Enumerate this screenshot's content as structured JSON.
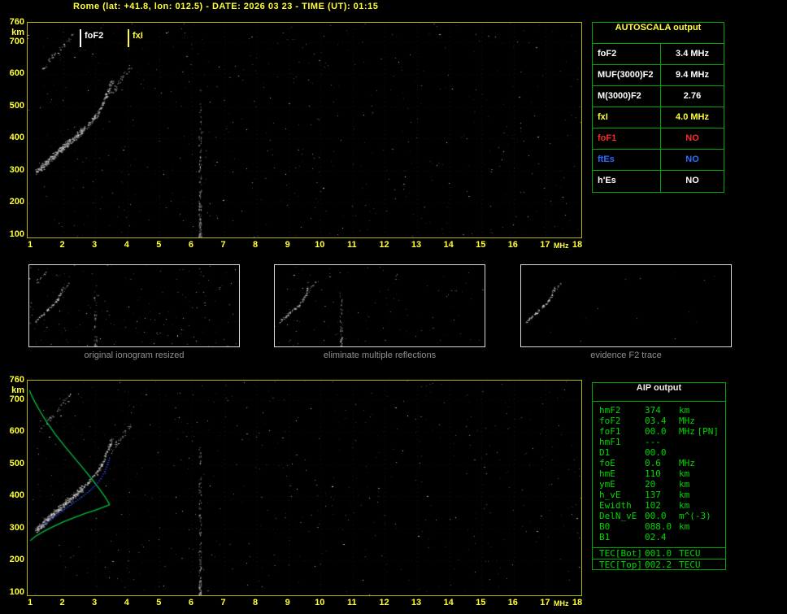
{
  "title": "Rome (lat: +41.8, lon: 012.5) - DATE: 2026 03 23 - TIME (UT): 01:15",
  "colors": {
    "axis_yellow": "#ffff35",
    "plot_border": "#b5b500",
    "table_green": "#00a800",
    "aip_text_green": "#00d800",
    "profile_green": "#00c23c",
    "fit_blue": "#2e4bff",
    "caption_gray": "#8f8f8f",
    "no_red": "#ff2a2a",
    "no_blue": "#2e6bff",
    "white": "#ffffff"
  },
  "autoscala_table": {
    "title": "AUTOSCALA output",
    "rows": [
      {
        "label": "foF2",
        "value": "3.4 MHz",
        "color": "#ffffff"
      },
      {
        "label": "MUF(3000)F2",
        "value": "9.4 MHz",
        "color": "#ffffff"
      },
      {
        "label": "M(3000)F2",
        "value": "2.76",
        "color": "#ffffff"
      },
      {
        "label": "fxI",
        "value": "4.0 MHz",
        "color": "#ffff35"
      },
      {
        "label": "foF1",
        "value": "NO",
        "color": "#ff2a2a"
      },
      {
        "label": "ftEs",
        "value": "NO",
        "color": "#2e6bff"
      },
      {
        "label": "h'Es",
        "value": "NO",
        "color": "#ffffff"
      }
    ]
  },
  "aip_table": {
    "title": "AIP output",
    "rows": [
      {
        "name": "hmF2",
        "value": "374",
        "unit": "km"
      },
      {
        "name": "foF2",
        "value": "03.4",
        "unit": "MHz"
      },
      {
        "name": "foF1",
        "value": "00.0",
        "unit": "MHz",
        "extra": "[PN]"
      },
      {
        "name": "hmF1",
        "value": "---",
        "unit": ""
      },
      {
        "name": "D1",
        "value": "00.0",
        "unit": ""
      },
      {
        "name": "foE",
        "value": "0.6",
        "unit": "MHz"
      },
      {
        "name": "hmE",
        "value": "110",
        "unit": "km"
      },
      {
        "name": "ymE",
        "value": "20",
        "unit": "km"
      },
      {
        "name": "h_vE",
        "value": "137",
        "unit": "km"
      },
      {
        "name": "Ewidth",
        "value": "102",
        "unit": "km"
      },
      {
        "name": "DelN_vE",
        "value": "00.0",
        "unit": "m^(-3)"
      },
      {
        "name": "B0",
        "value": "088.0",
        "unit": "km"
      },
      {
        "name": "B1",
        "value": "02.4",
        "unit": ""
      }
    ],
    "tec_rows": [
      {
        "name": "TEC[Bot]",
        "value": "001.0",
        "unit": "TECU"
      },
      {
        "name": "TEC[Top]",
        "value": "002.2",
        "unit": "TECU"
      }
    ]
  },
  "thumbnails": [
    {
      "caption": "original ionogram resized"
    },
    {
      "caption": "eliminate multiple reflections"
    },
    {
      "caption": "evidence F2 trace"
    }
  ],
  "chart_data": [
    {
      "type": "scatter",
      "title": "measured ionogram",
      "xlabel": "MHz",
      "ylabel": "km",
      "xlim": [
        1,
        18
      ],
      "ylim": [
        92,
        760
      ],
      "x_ticks": [
        1,
        2,
        3,
        4,
        5,
        6,
        7,
        8,
        9,
        10,
        11,
        12,
        13,
        14,
        15,
        16,
        17,
        18
      ],
      "y_ticks": [
        760,
        700,
        600,
        500,
        400,
        300,
        200,
        100
      ],
      "grid": "faint dotted",
      "markers": [
        {
          "label": "foF2",
          "value_mhz": 3.4,
          "color": "#ffffff"
        },
        {
          "label": "fxI",
          "value_mhz": 4.0,
          "color": "#ffff35"
        }
      ],
      "f2_trace": [
        [
          1.15,
          295
        ],
        [
          1.4,
          318
        ],
        [
          1.7,
          346
        ],
        [
          2.0,
          373
        ],
        [
          2.3,
          399
        ],
        [
          2.6,
          426
        ],
        [
          2.85,
          452
        ],
        [
          3.05,
          477
        ],
        [
          3.2,
          502
        ],
        [
          3.32,
          528
        ],
        [
          3.42,
          556
        ],
        [
          3.52,
          580
        ]
      ],
      "x_trace": [
        [
          3.5,
          538
        ],
        [
          3.65,
          563
        ],
        [
          3.8,
          586
        ],
        [
          3.95,
          605
        ],
        [
          4.12,
          620
        ]
      ],
      "second_hop": [
        [
          1.3,
          612
        ],
        [
          1.55,
          640
        ],
        [
          1.8,
          668
        ],
        [
          2.05,
          696
        ],
        [
          2.28,
          720
        ]
      ],
      "interference_mhz": 6.25
    },
    {
      "type": "scatter",
      "title": "ionogram with AIP profile fit",
      "xlabel": "MHz",
      "ylabel": "km",
      "xlim": [
        1,
        18
      ],
      "ylim": [
        92,
        760
      ],
      "x_ticks": [
        1,
        2,
        3,
        4,
        5,
        6,
        7,
        8,
        9,
        10,
        11,
        12,
        13,
        14,
        15,
        16,
        17,
        18
      ],
      "y_ticks": [
        760,
        700,
        600,
        500,
        400,
        300,
        200,
        100
      ],
      "grid": "faint dotted",
      "f2_trace": [
        [
          1.15,
          295
        ],
        [
          1.4,
          318
        ],
        [
          1.7,
          346
        ],
        [
          2.0,
          373
        ],
        [
          2.3,
          399
        ],
        [
          2.6,
          426
        ],
        [
          2.85,
          452
        ],
        [
          3.05,
          477
        ],
        [
          3.2,
          502
        ],
        [
          3.32,
          528
        ],
        [
          3.42,
          556
        ],
        [
          3.52,
          580
        ]
      ],
      "x_trace": [
        [
          3.5,
          538
        ],
        [
          3.65,
          563
        ],
        [
          3.8,
          586
        ],
        [
          3.95,
          605
        ],
        [
          4.12,
          620
        ]
      ],
      "second_hop": [
        [
          1.3,
          612
        ],
        [
          1.55,
          640
        ],
        [
          1.8,
          668
        ],
        [
          2.05,
          696
        ],
        [
          2.28,
          720
        ]
      ],
      "interference_mhz": 6.25,
      "green_profile_bottomside": [
        [
          0.98,
          262
        ],
        [
          1.15,
          276
        ],
        [
          1.4,
          291
        ],
        [
          1.7,
          306
        ],
        [
          2.0,
          320
        ],
        [
          2.35,
          334
        ],
        [
          2.7,
          347
        ],
        [
          3.0,
          357
        ],
        [
          3.25,
          366
        ],
        [
          3.45,
          374
        ]
      ],
      "green_profile_topside": [
        [
          3.45,
          374
        ],
        [
          3.32,
          396
        ],
        [
          3.15,
          420
        ],
        [
          2.92,
          450
        ],
        [
          2.65,
          484
        ],
        [
          2.35,
          520
        ],
        [
          2.05,
          556
        ],
        [
          1.75,
          594
        ],
        [
          1.5,
          630
        ],
        [
          1.3,
          662
        ],
        [
          1.12,
          694
        ],
        [
          1.0,
          718
        ],
        [
          0.96,
          730
        ]
      ],
      "blue_fit": [
        [
          1.4,
          312
        ],
        [
          1.65,
          332
        ],
        [
          1.95,
          355
        ],
        [
          2.25,
          377
        ],
        [
          2.55,
          399
        ],
        [
          2.8,
          418
        ],
        [
          3.0,
          437
        ],
        [
          3.15,
          456
        ],
        [
          3.27,
          478
        ],
        [
          3.36,
          500
        ],
        [
          3.42,
          520
        ]
      ]
    }
  ]
}
